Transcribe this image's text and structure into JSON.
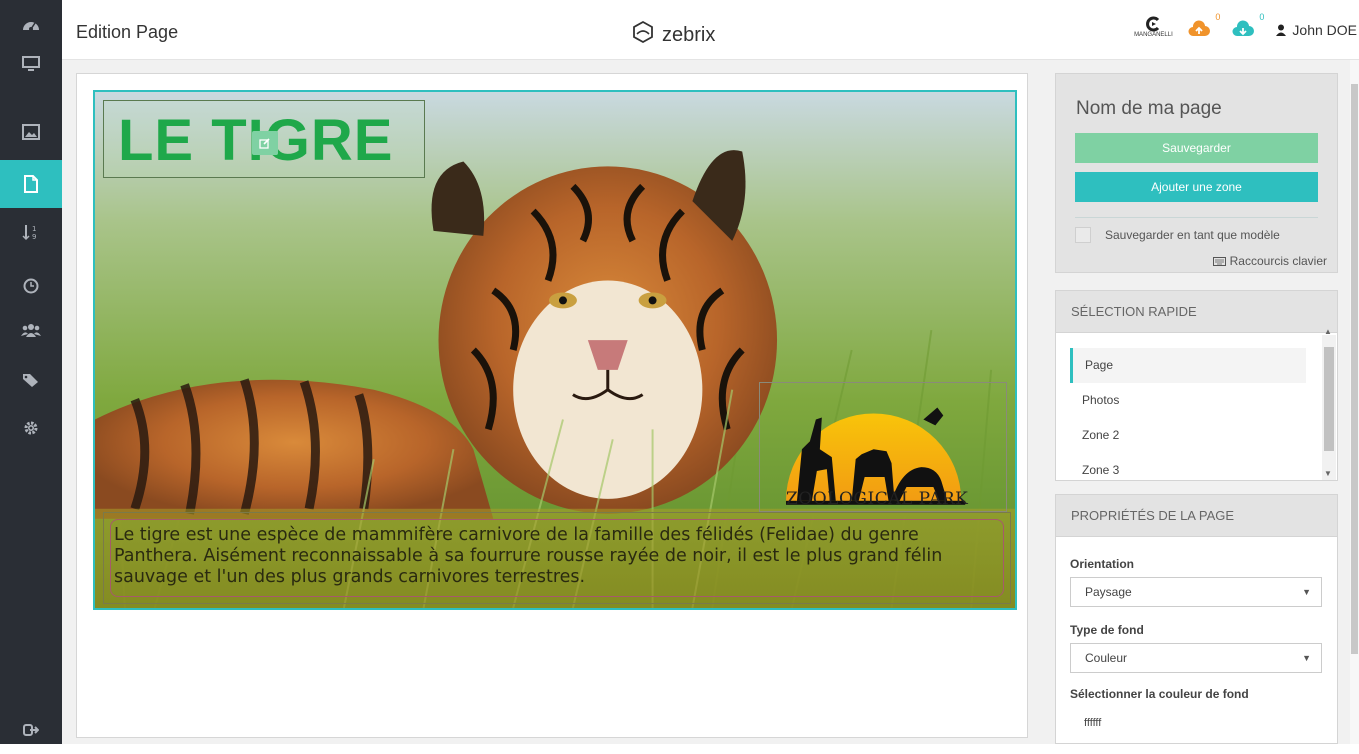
{
  "header": {
    "page_title": "Edition Page",
    "brand": "zebrix",
    "partner_logo_text": "MANGANELLI",
    "upload_count": "0",
    "download_count": "0",
    "user_name": "John DOE"
  },
  "sidebar": {
    "items": [
      {
        "icon": "dashboard-icon"
      },
      {
        "icon": "monitor-icon"
      },
      {
        "icon": "image-icon"
      },
      {
        "icon": "page-icon",
        "active": true
      },
      {
        "icon": "sort-numeric-icon"
      },
      {
        "icon": "clock-icon"
      },
      {
        "icon": "users-icon"
      },
      {
        "icon": "tags-icon"
      },
      {
        "icon": "gear-icon"
      },
      {
        "icon": "logout-icon"
      }
    ]
  },
  "canvas": {
    "title_zone_text": "LE TIGRE",
    "logo_text": "ZOOLOGICAL PARK",
    "description": "Le tigre est une espèce de mammifère carnivore de la famille des félidés (Felidae) du genre Panthera. Aisément reconnaissable à sa fourrure rousse rayée de noir, il est le plus grand félin sauvage et l'un des plus grands carnivores terrestres."
  },
  "page_panel": {
    "page_name": "Nom de ma page",
    "save_label": "Sauvegarder",
    "add_zone_label": "Ajouter une zone",
    "save_as_template_label": "Sauvegarder en tant que modèle",
    "keyboard_shortcuts_label": "Raccourcis clavier"
  },
  "quick_select": {
    "heading": "SÉLECTION RAPIDE",
    "items": [
      "Page",
      "Photos",
      "Zone 2",
      "Zone 3"
    ]
  },
  "page_properties": {
    "heading": "PROPRIÉTÉS DE LA PAGE",
    "orientation_label": "Orientation",
    "orientation_value": "Paysage",
    "background_type_label": "Type de fond",
    "background_type_value": "Couleur",
    "background_color_label": "Sélectionner la couleur de fond",
    "background_color_value": "ffffff"
  },
  "colors": {
    "accent": "#2ebfbf",
    "save_button": "#7fd1a3",
    "sidebar_bg": "#2a2e35",
    "title_green": "#1fa84a"
  }
}
